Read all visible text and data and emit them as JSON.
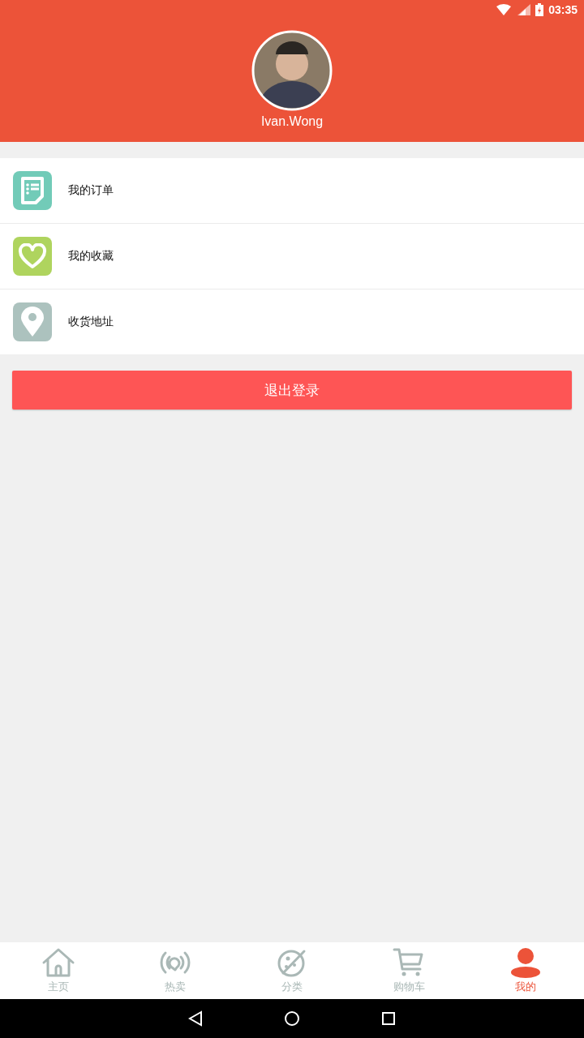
{
  "status_bar": {
    "time": "03:35"
  },
  "profile": {
    "username": "Ivan.Wong"
  },
  "menu": [
    {
      "kind": "orders",
      "label": "我的订单",
      "color": "#72cbb8"
    },
    {
      "kind": "favorites",
      "label": "我的收藏",
      "color": "#afd45e"
    },
    {
      "kind": "address",
      "label": "收货地址",
      "color": "#acc2be"
    }
  ],
  "logout_button": "退出登录",
  "bottom_nav": [
    {
      "kind": "home",
      "label": "主页",
      "selected": false
    },
    {
      "kind": "hot",
      "label": "热卖",
      "selected": false
    },
    {
      "kind": "category",
      "label": "分类",
      "selected": false
    },
    {
      "kind": "cart",
      "label": "购物车",
      "selected": false
    },
    {
      "kind": "me",
      "label": "我的",
      "selected": true
    }
  ]
}
